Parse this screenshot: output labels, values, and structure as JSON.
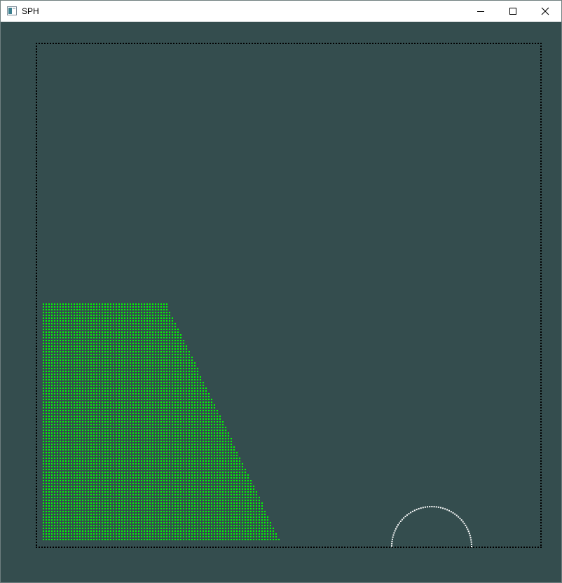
{
  "window": {
    "title": "SPH",
    "controls": [
      {
        "name": "minimize-icon"
      },
      {
        "name": "maximize-icon"
      },
      {
        "name": "close-icon"
      }
    ]
  },
  "colors": {
    "background": "#344d4e",
    "boundary_particles": "#000000",
    "fluid_particles": "#00ff00",
    "obstacle_particles": "#ffffff",
    "titlebar": "#ffffff"
  }
}
